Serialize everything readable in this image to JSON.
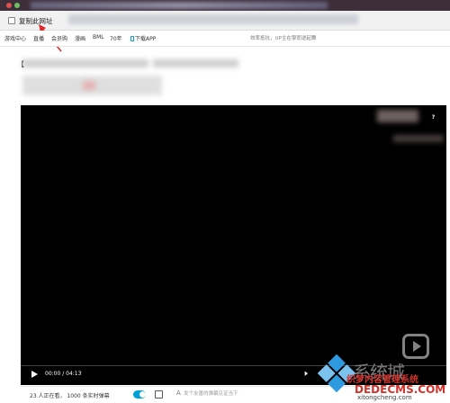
{
  "browser": {
    "copy_url_label": "复制此网址"
  },
  "site_nav": {
    "items": [
      "游戏中心",
      "直播",
      "会员购",
      "漫画",
      "BML",
      "70年"
    ],
    "download_app": "下载APP",
    "search_placeholder": "效率抵抗，UP主在學而逆起舞"
  },
  "title": {
    "bracket": "【"
  },
  "player": {
    "time": "00:00 / 04:13",
    "help": "?"
  },
  "danmaku": {
    "viewers": "23 人正在看， 1000 条实时弹幕",
    "input_placeholder": "发个友善的弹幕见证当下"
  },
  "watermark": {
    "cn_text": "系统城",
    "line1": "织梦内容管理系统",
    "line2": "DEDECMS.COM",
    "line3": "xitongcheng.com",
    "colors": {
      "red": "#d0342c",
      "gray": "#9b9b9b"
    }
  },
  "colors": {
    "accent": "#00a1d6",
    "chrome": "#3d2f3a",
    "arrow": "#e0282b"
  }
}
